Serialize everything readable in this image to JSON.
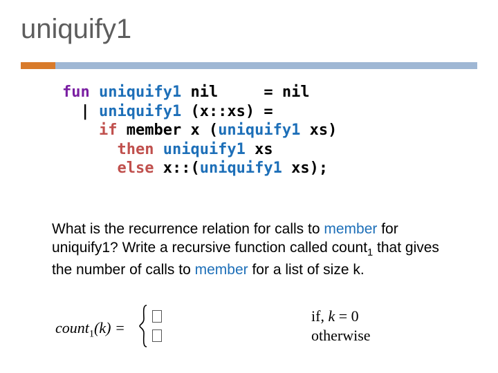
{
  "title": "uniquify1",
  "code": {
    "l1_fun": "fun",
    "l1_name1": "uniquify1",
    "l1_rest1": " nil     = nil",
    "l2_bar": "  |",
    "l2_name": " uniquify1",
    "l2_rest": " (x::xs) =",
    "l3_indent": "    ",
    "l3_if": "if",
    "l3_mid": " member x (",
    "l3_name": "uniquify1",
    "l3_rest": " xs)",
    "l4_indent": "      ",
    "l4_then": "then",
    "l4_name": " uniquify1",
    "l4_rest": " xs",
    "l5_indent": "      ",
    "l5_else": "else",
    "l5_mid": " x::(",
    "l5_name": "uniquify1",
    "l5_rest": " xs);"
  },
  "question": {
    "p1": "What is the recurrence relation for calls to ",
    "member1": "member",
    "p2": " for uniquify1?  Write a recursive function called count",
    "sub1": "1",
    "p3": " that gives the number of calls to ",
    "member2": "member",
    "p4": " for a list of size k."
  },
  "equation": {
    "lhs_count": "count",
    "lhs_sub": "1",
    "lhs_arg": "(k) = ",
    "case1_value": "",
    "case2_value": "",
    "cond1_if": "if, ",
    "cond1_k": "k",
    "cond1_rest": " = 0",
    "cond2": "otherwise"
  },
  "chart_data": null
}
